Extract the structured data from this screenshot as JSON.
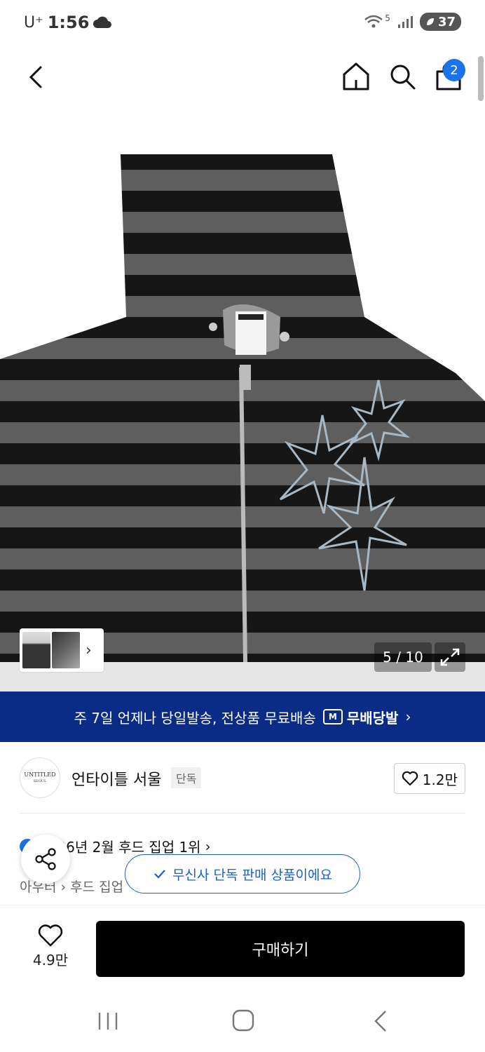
{
  "status_bar": {
    "carrier": "U⁺",
    "time": "1:56",
    "network": "5",
    "battery": "37"
  },
  "nav": {
    "back_icon": "chevron-left-icon",
    "home_icon": "home-icon",
    "search_icon": "search-icon",
    "cart_icon": "shopping-bag-icon",
    "cart_badge": "2"
  },
  "gallery": {
    "counter": "5 / 10",
    "expand_icon": "expand-icon"
  },
  "banner": {
    "text": "주 7일 언제나 당일발송, 전상품 무료배송",
    "logo_mark": "M",
    "logo_text": "무배당발",
    "chevron": "›"
  },
  "brand": {
    "logo_text": "UNTITLED",
    "logo_sub": "SEOUL",
    "name": "언타이틀 서울",
    "tag": "단독",
    "like_count": "1.2만"
  },
  "ranking": {
    "text": "2026년 2월 후드 집업 1위",
    "chevron": "›"
  },
  "breadcrumb": {
    "text": "아우터 › 후드 집업"
  },
  "toast": {
    "text": "무신사 단독 판매 상품이에요"
  },
  "action_bar": {
    "like_count": "4.9만",
    "buy_label": "구매하기"
  },
  "colors": {
    "banner_bg": "#0a2c86",
    "accent_blue": "#1a73e8",
    "buy_bg": "#000000"
  }
}
